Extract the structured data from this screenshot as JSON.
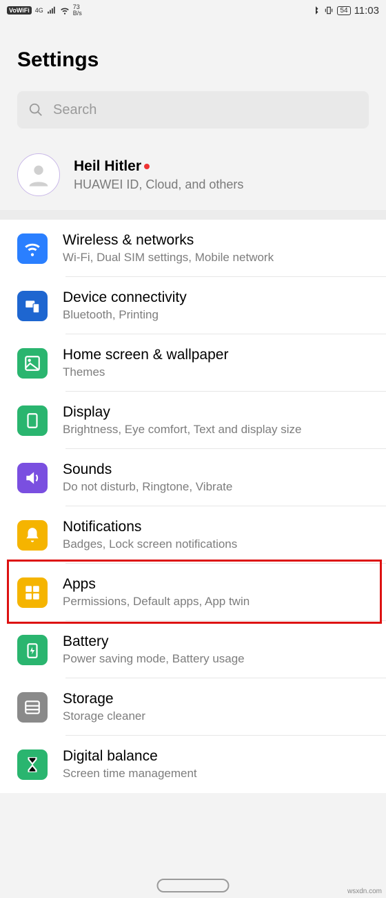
{
  "status": {
    "vowifi": "VoWiFi",
    "net_gen": "4G",
    "speed_top": "73",
    "speed_bot": "B/s",
    "battery": "54",
    "time": "11:03"
  },
  "page_title": "Settings",
  "search": {
    "placeholder": "Search"
  },
  "account": {
    "name": "Heil Hitler",
    "subtitle": "HUAWEI ID, Cloud, and others"
  },
  "items": [
    {
      "title": "Wireless & networks",
      "sub": "Wi-Fi, Dual SIM settings, Mobile network",
      "color": "#2a7fff",
      "icon": "wifi"
    },
    {
      "title": "Device connectivity",
      "sub": "Bluetooth, Printing",
      "color": "#1e66d0",
      "icon": "device"
    },
    {
      "title": "Home screen & wallpaper",
      "sub": "Themes",
      "color": "#2ab56f",
      "icon": "wallpaper"
    },
    {
      "title": "Display",
      "sub": "Brightness, Eye comfort, Text and display size",
      "color": "#2ab56f",
      "icon": "display"
    },
    {
      "title": "Sounds",
      "sub": "Do not disturb, Ringtone, Vibrate",
      "color": "#7a4fe0",
      "icon": "sound"
    },
    {
      "title": "Notifications",
      "sub": "Badges, Lock screen notifications",
      "color": "#f5b400",
      "icon": "bell"
    },
    {
      "title": "Apps",
      "sub": "Permissions, Default apps, App twin",
      "color": "#f5b400",
      "icon": "apps",
      "highlight": true
    },
    {
      "title": "Battery",
      "sub": "Power saving mode, Battery usage",
      "color": "#2ab56f",
      "icon": "battery"
    },
    {
      "title": "Storage",
      "sub": "Storage cleaner",
      "color": "#8a8a8a",
      "icon": "storage"
    },
    {
      "title": "Digital balance",
      "sub": "Screen time management",
      "color": "#2ab56f",
      "icon": "hourglass"
    }
  ],
  "watermark": "wsxdn.com"
}
